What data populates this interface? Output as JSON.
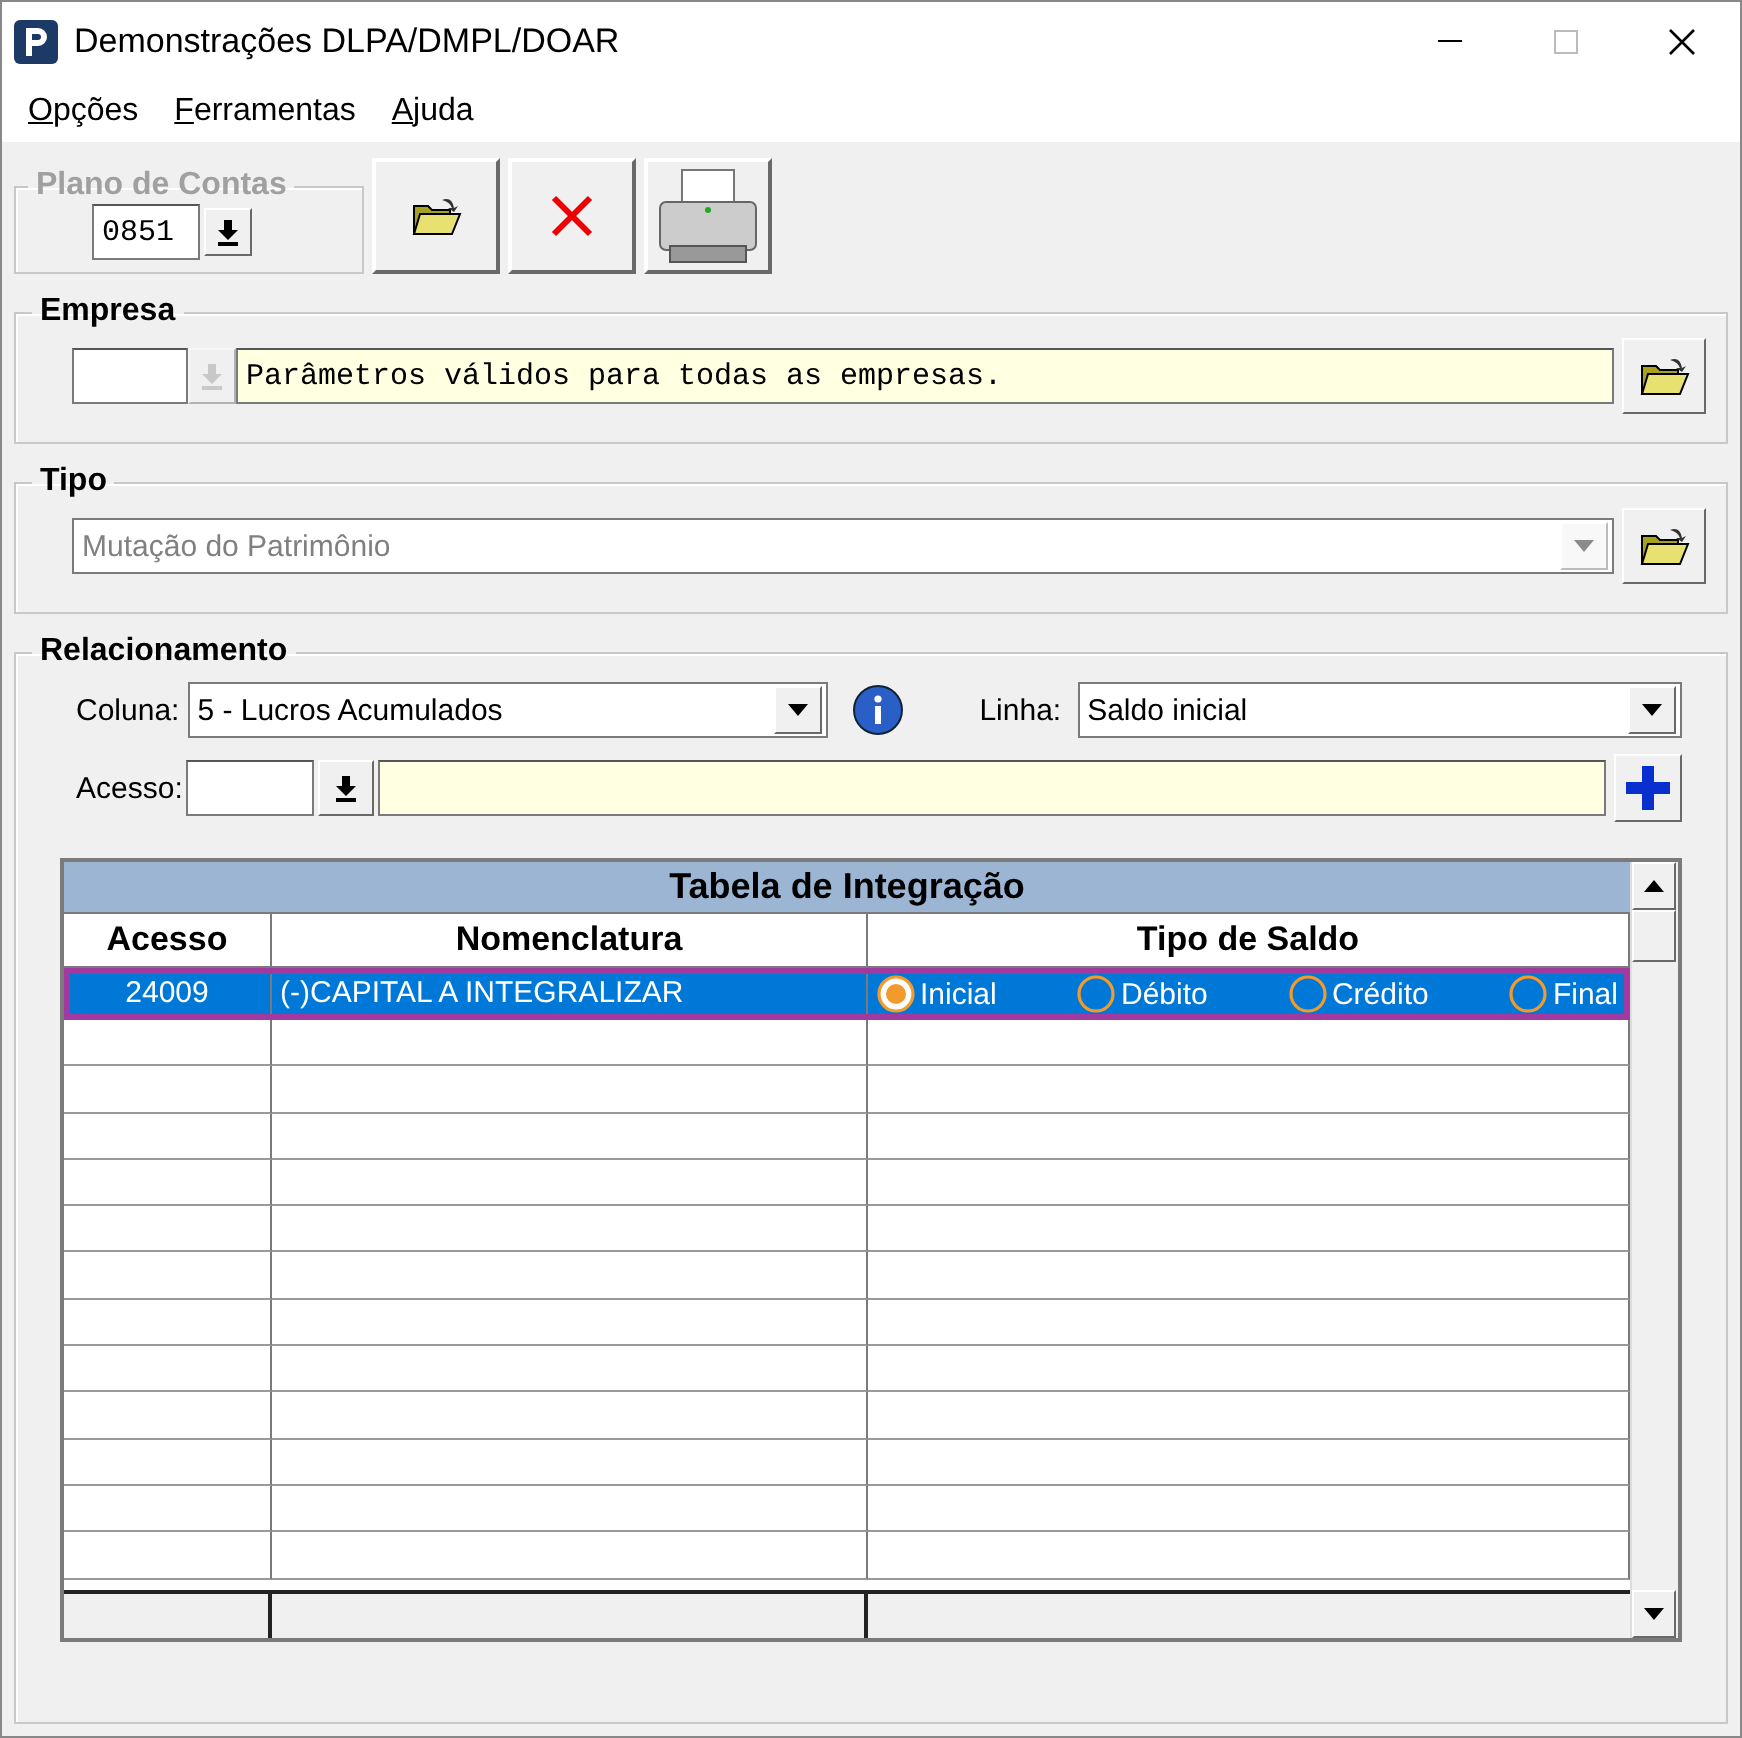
{
  "window": {
    "title": "Demonstrações DLPA/DMPL/DOAR"
  },
  "menu": [
    {
      "label": "Opções"
    },
    {
      "label": "Ferramentas"
    },
    {
      "label": "Ajuda"
    }
  ],
  "plano_de_contas": {
    "label": "Plano de Contas",
    "value": "0851"
  },
  "empresa": {
    "label": "Empresa",
    "description": "Parâmetros válidos para todas as empresas."
  },
  "tipo": {
    "label": "Tipo",
    "value": "Mutação do Patrimônio",
    "disabled": true
  },
  "relacionamento": {
    "label": "Relacionamento",
    "coluna_label": "Coluna:",
    "coluna": "5 - Lucros Acumulados",
    "linha_label": "Linha:",
    "linha": "Saldo inicial",
    "acesso_label": "Acesso:"
  },
  "table": {
    "title": "Tabela de Integração",
    "columns": [
      "Acesso",
      "Nomenclatura",
      "Tipo de Saldo"
    ],
    "rows": [
      {
        "acesso": "24009",
        "nomenclatura": "(-)CAPITAL A INTEGRALIZAR",
        "selected": true,
        "options": [
          {
            "label": "Inicial",
            "selected": true
          },
          {
            "label": "Débito",
            "selected": false
          },
          {
            "label": "Crédito",
            "selected": false
          },
          {
            "label": "Final",
            "selected": false
          }
        ]
      }
    ]
  }
}
